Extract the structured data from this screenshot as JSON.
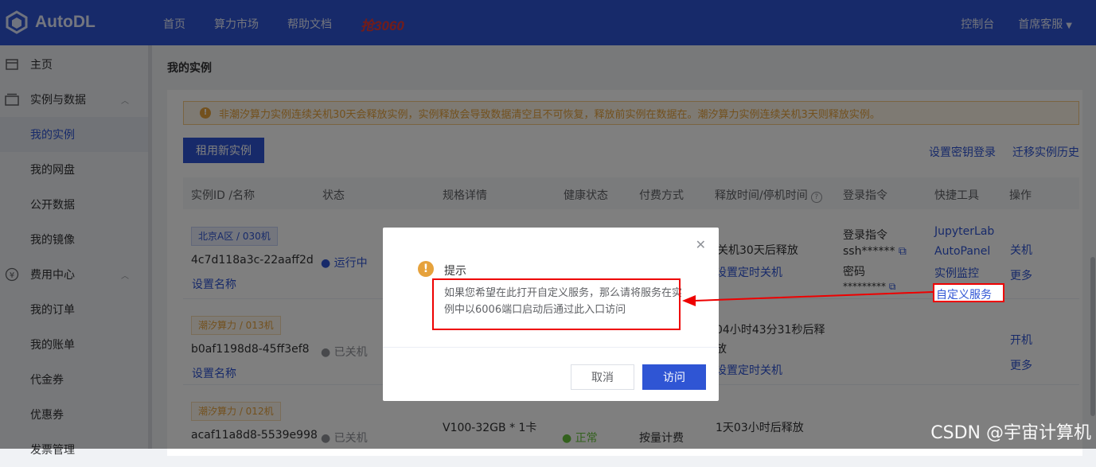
{
  "brand": {
    "name": "AutoDL"
  },
  "topnav": {
    "items": [
      "首页",
      "算力市场",
      "帮助文档"
    ],
    "promo": "抢3060"
  },
  "topright": {
    "console": "控制台",
    "support": "首席客服"
  },
  "sidebar": {
    "items": [
      {
        "label": "主页",
        "icon": "home-icon"
      },
      {
        "label": "实例与数据",
        "icon": "folder-icon",
        "chevron": "chevron-up-icon"
      },
      {
        "label": "我的实例",
        "active": true
      },
      {
        "label": "我的网盘"
      },
      {
        "label": "公开数据"
      },
      {
        "label": "我的镜像"
      },
      {
        "label": "费用中心",
        "icon": "yen-icon",
        "chevron": "chevron-up-icon"
      },
      {
        "label": "我的订单"
      },
      {
        "label": "我的账单"
      },
      {
        "label": "代金券"
      },
      {
        "label": "优惠券"
      },
      {
        "label": "发票管理"
      }
    ]
  },
  "page": {
    "title": "我的实例",
    "alert": "非潮汐算力实例连续关机30天会释放实例，实例释放会导致数据清空且不可恢复，释放前实例在数据在。潮汐算力实例连续关机3天则释放实例。",
    "rent_button": "租用新实例",
    "links": {
      "key_login": "设置密钥登录",
      "migrate_history": "迁移实例历史"
    }
  },
  "table": {
    "headers": [
      "实例ID /名称",
      "状态",
      "规格详情",
      "健康状态",
      "付费方式",
      "释放时间/停机时间",
      "登录指令",
      "快捷工具",
      "操作"
    ],
    "rows": [
      {
        "tag": "北京A区 / 030机",
        "tag_color": "#2f55d4",
        "id": "4c7d118a3c-22aaff2d",
        "set_name": "设置名称",
        "status": "运行中",
        "release": "关机30天后释放",
        "timer": "设置定时关机",
        "login_cmd_label": "登录指令",
        "ssh": "ssh******",
        "pwd_label": "密码",
        "pwd": "*********",
        "tools": [
          "JupyterLab",
          "AutoPanel",
          "实例监控",
          "自定义服务"
        ],
        "ops": [
          "关机",
          "更多"
        ]
      },
      {
        "tag": "潮汐算力 / 013机",
        "tag_color": "#e6a23c",
        "id": "b0af1198d8-45ff3ef8",
        "set_name": "设置名称",
        "status": "已关机",
        "release_l1": "04小时43分31秒后释",
        "release_l2": "放",
        "timer": "设置定时关机",
        "ops": [
          "开机",
          "更多"
        ]
      },
      {
        "tag": "潮汐算力 / 012机",
        "tag_color": "#e6a23c",
        "id": "acaf11a8d8-5539e998",
        "status": "已关机",
        "spec": "V100-32GB * 1卡",
        "health": "正常",
        "billing": "按量计费",
        "release": "1天03小时后释放"
      }
    ]
  },
  "dialog": {
    "title": "提示",
    "message": "如果您希望在此打开自定义服务，那么请将服务在实例中以6006端口启动后通过此入口访问",
    "cancel": "取消",
    "confirm": "访问"
  },
  "watermark": "CSDN @宇宙计算机",
  "colors": {
    "primary": "#2f55d4",
    "warning": "#e6a23c",
    "annotation": "#e00000"
  }
}
